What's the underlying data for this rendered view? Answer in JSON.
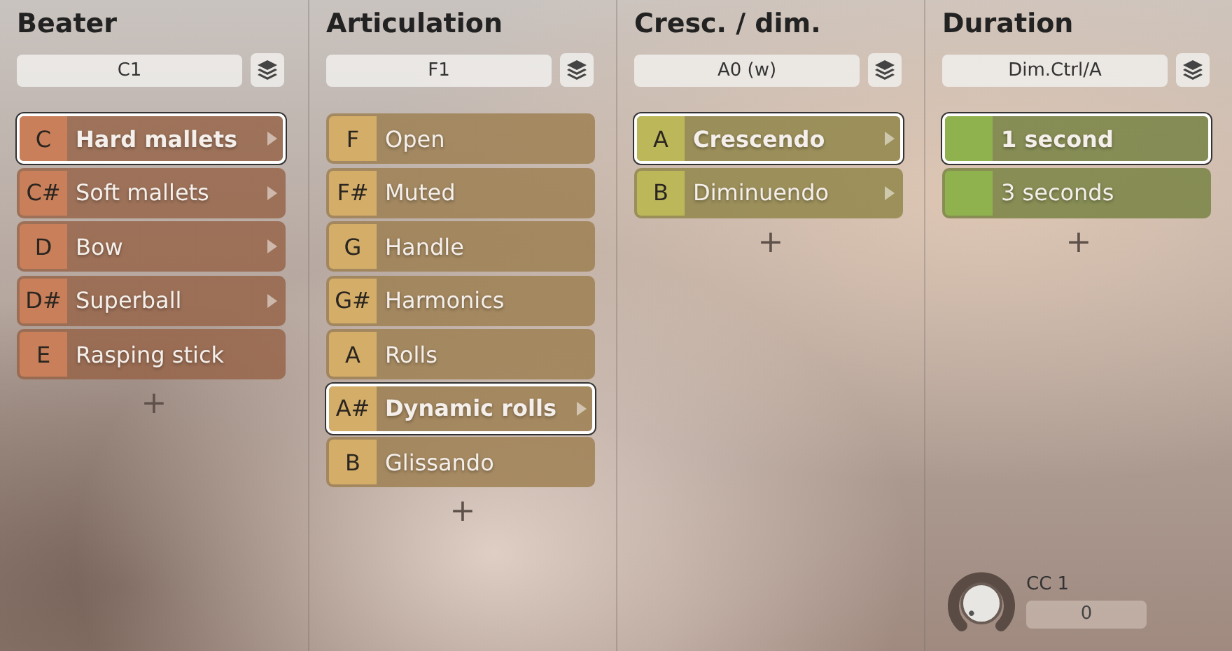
{
  "columns": [
    {
      "title": "Beater",
      "field": "C1",
      "color": "#c9805a",
      "items": [
        {
          "key": "C",
          "label": "Hard mallets",
          "submenu": true,
          "selected": true
        },
        {
          "key": "C#",
          "label": "Soft mallets",
          "submenu": true,
          "selected": false
        },
        {
          "key": "D",
          "label": "Bow",
          "submenu": true,
          "selected": false
        },
        {
          "key": "D#",
          "label": "Superball",
          "submenu": true,
          "selected": false
        },
        {
          "key": "E",
          "label": "Rasping stick",
          "submenu": false,
          "selected": false
        }
      ],
      "add": "+"
    },
    {
      "title": "Articulation",
      "field": "F1",
      "color": "#d4ae68",
      "items": [
        {
          "key": "F",
          "label": "Open",
          "submenu": false,
          "selected": false
        },
        {
          "key": "F#",
          "label": "Muted",
          "submenu": false,
          "selected": false
        },
        {
          "key": "G",
          "label": "Handle",
          "submenu": false,
          "selected": false
        },
        {
          "key": "G#",
          "label": "Harmonics",
          "submenu": false,
          "selected": false
        },
        {
          "key": "A",
          "label": "Rolls",
          "submenu": false,
          "selected": false
        },
        {
          "key": "A#",
          "label": "Dynamic rolls",
          "submenu": true,
          "selected": true
        },
        {
          "key": "B",
          "label": "Glissando",
          "submenu": false,
          "selected": false
        }
      ],
      "add": "+"
    },
    {
      "title": "Cresc. / dim.",
      "field": "A0 (w)",
      "color": "#bcb85a",
      "items": [
        {
          "key": "A",
          "label": "Crescendo",
          "submenu": true,
          "selected": true
        },
        {
          "key": "B",
          "label": "Diminuendo",
          "submenu": true,
          "selected": false
        }
      ],
      "add": "+"
    },
    {
      "title": "Duration",
      "field": "Dim.Ctrl/A",
      "color": "#8fb24e",
      "items": [
        {
          "label": "1 second",
          "submenu": false,
          "selected": true
        },
        {
          "label": "3 seconds",
          "submenu": false,
          "selected": false
        }
      ],
      "add": "+",
      "knob": {
        "label": "CC 1",
        "value": "0"
      }
    }
  ]
}
